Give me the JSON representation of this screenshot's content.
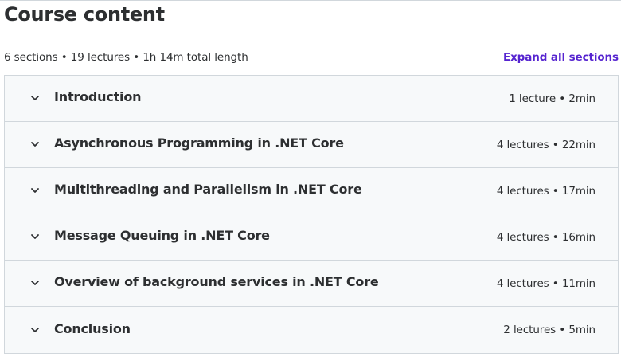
{
  "header": {
    "title": "Course content",
    "summary": "6 sections • 19 lectures • 1h 14m total length",
    "expand_label": "Expand all sections"
  },
  "sections": [
    {
      "title": "Introduction",
      "meta": "1 lecture • 2min"
    },
    {
      "title": "Asynchronous Programming in .NET Core",
      "meta": "4 lectures • 22min"
    },
    {
      "title": "Multithreading and Parallelism in .NET Core",
      "meta": "4 lectures • 17min"
    },
    {
      "title": "Message Queuing in .NET Core",
      "meta": "4 lectures • 16min"
    },
    {
      "title": "Overview of background services in .NET Core",
      "meta": "4 lectures • 11min"
    },
    {
      "title": "Conclusion",
      "meta": "2 lectures • 5min"
    }
  ],
  "colors": {
    "accent": "#5624d0",
    "text": "#2d2f31",
    "section_bg": "#f7f9fa",
    "border": "#d1d7dc"
  },
  "icons": {
    "section_toggle": "chevron-down-icon"
  }
}
